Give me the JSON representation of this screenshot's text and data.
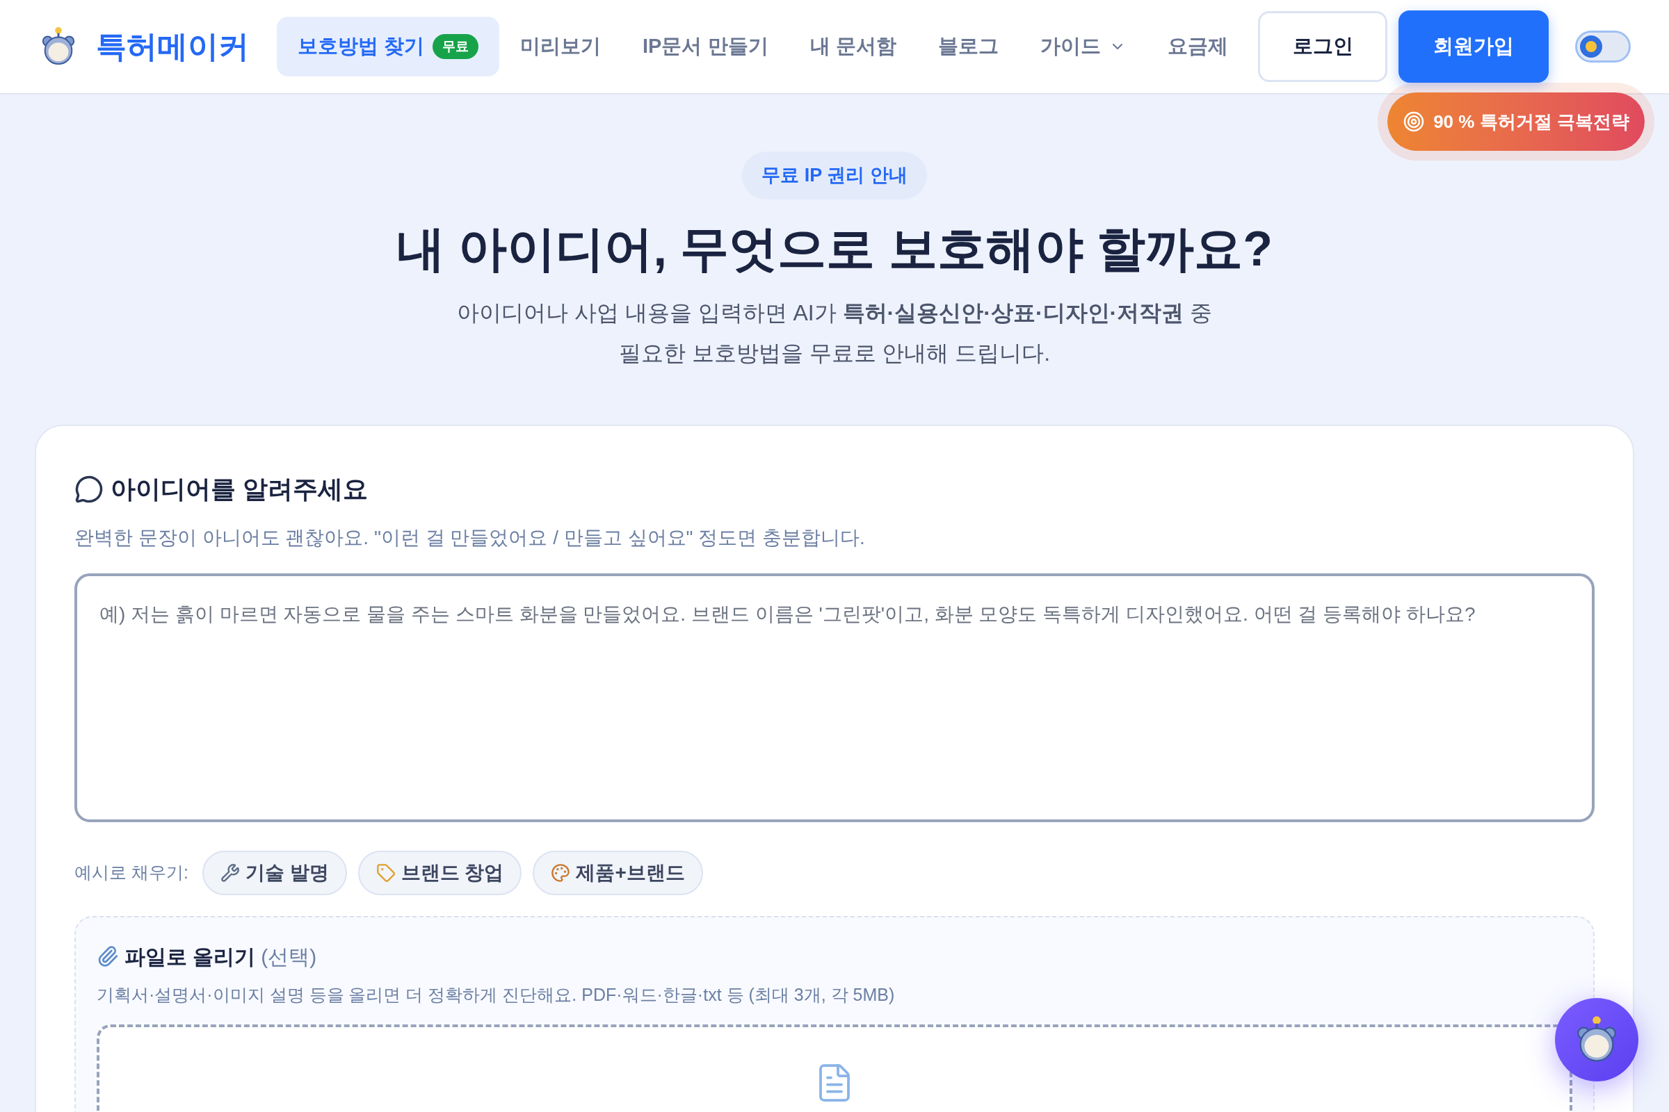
{
  "header": {
    "brand": "특허메이커",
    "nav": [
      {
        "label": "보호방법 찾기",
        "badge": "무료",
        "selected": true,
        "dropdown": false
      },
      {
        "label": "미리보기",
        "selected": false,
        "dropdown": false
      },
      {
        "label": "IP문서 만들기",
        "selected": false,
        "dropdown": false
      },
      {
        "label": "내 문서함",
        "selected": false,
        "dropdown": false
      },
      {
        "label": "블로그",
        "selected": false,
        "dropdown": false
      },
      {
        "label": "가이드",
        "selected": false,
        "dropdown": true
      },
      {
        "label": "요금제",
        "selected": false,
        "dropdown": false
      }
    ],
    "login": "로그인",
    "signup": "회원가입",
    "theme_toggle": {
      "on": false
    },
    "promo": "90 % 특허거절 극복전략"
  },
  "hero": {
    "eyebrow": "무료 IP 권리 안내",
    "title": "내 아이디어, 무엇으로 보호해야 할까요?",
    "subtitle": [
      "아이디어나 사업 내용을 입력하면 AI가 **특허·실용신안·상표·디자인·저작권** 중",
      "필요한 보호방법을 무료로 안내해 드립니다."
    ]
  },
  "form": {
    "title": "아이디어를 알려주세요",
    "hint": "완벽한 문장이 아니어도 괜찮아요. \"이런 걸 만들었어요 / 만들고 싶어요\" 정도면 충분합니다.",
    "idea_field": {
      "placeholder": "예) 저는 흙이 마르면 자동으로 물을 주는 스마트 화분을 만들었어요. 브랜드 이름은 '그린팟'이고, 화분 모양도 독특하게 디자인했어요. 어떤 걸 등록해야 하나요?"
    },
    "examples_label": "예시로 채우기:",
    "examples": [
      {
        "label": "기술 발명",
        "kind": "wrench"
      },
      {
        "label": "브랜드 창업",
        "kind": "tag"
      },
      {
        "label": "제품+브랜드",
        "kind": "palette"
      }
    ],
    "upload": {
      "title": "파일로 올리기",
      "optional": "(선택)",
      "hint": "기획서·설명서·이미지 설명 등을 올리면 더 정확하게 진단해요. PDF·워드·한글·txt 등 (최대 3개, 각 5MB)"
    }
  }
}
